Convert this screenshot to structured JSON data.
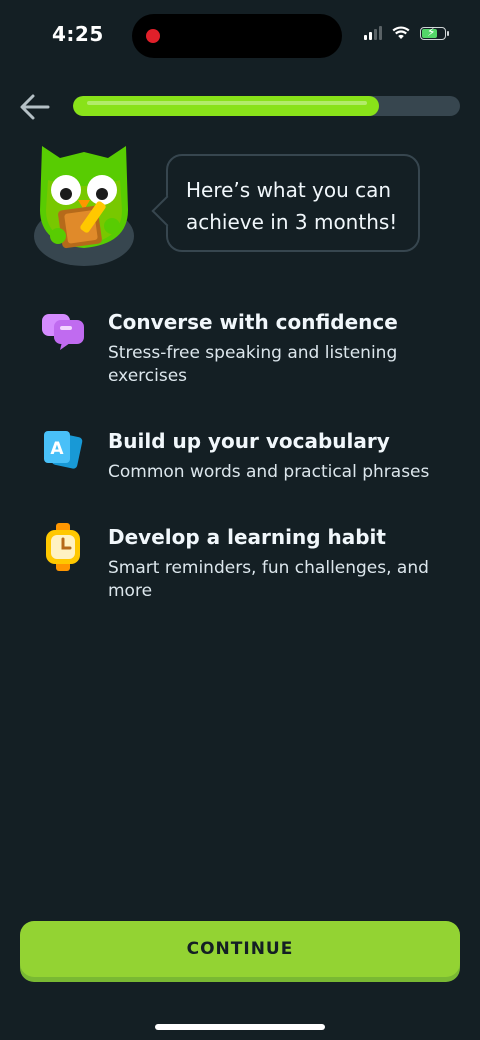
{
  "status_bar": {
    "time": "4:25"
  },
  "progress": {
    "value": 0.79
  },
  "speech_bubble": {
    "text": "Here’s what you can achieve in 3 months!"
  },
  "features": [
    {
      "icon": "speech-bubbles-icon",
      "title": "Converse with confidence",
      "description": "Stress-free speaking and listening exercises"
    },
    {
      "icon": "vocabulary-cards-icon",
      "title": "Build up your vocabulary",
      "description": "Common words and practical phrases"
    },
    {
      "icon": "watch-icon",
      "title": "Develop a learning habit",
      "description": "Smart reminders, fun challenges, and more"
    }
  ],
  "continue_label": "CONTINUE",
  "colors": {
    "background": "#141f24",
    "accent_green": "#93d333",
    "progress_fill": "#89e219",
    "track": "#37464f"
  }
}
